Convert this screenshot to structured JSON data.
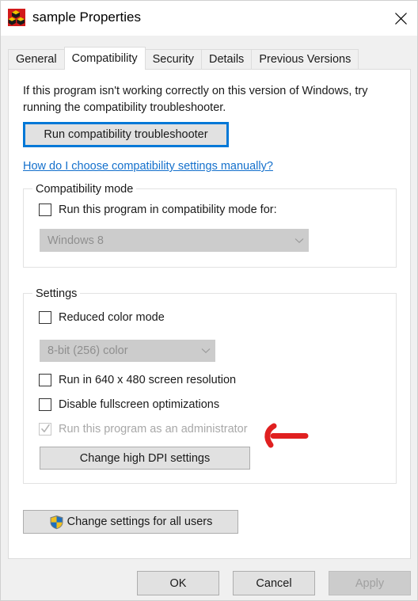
{
  "window": {
    "title": "sample Properties",
    "icon": "application-blocks-icon",
    "close_label": "✕"
  },
  "tabs": [
    {
      "label": "General",
      "active": false
    },
    {
      "label": "Compatibility",
      "active": true
    },
    {
      "label": "Security",
      "active": false
    },
    {
      "label": "Details",
      "active": false
    },
    {
      "label": "Previous Versions",
      "active": false
    }
  ],
  "compatibility_tab": {
    "description": "If this program isn't working correctly on this version of Windows, try running the compatibility troubleshooter.",
    "troubleshoot_button": "Run compatibility troubleshooter",
    "help_link": "How do I choose compatibility settings manually?",
    "compatibility_mode_group": {
      "title": "Compatibility mode",
      "checkbox_label": "Run this program in compatibility mode for:",
      "checkbox_checked": false,
      "os_dropdown_value": "Windows 8",
      "os_dropdown_disabled": true
    },
    "settings_group": {
      "title": "Settings",
      "reduced_color_label": "Reduced color mode",
      "reduced_color_checked": false,
      "color_depth_value": "8-bit (256) color",
      "color_depth_disabled": true,
      "low_resolution_label": "Run in 640 x 480 screen resolution",
      "low_resolution_checked": false,
      "disable_fullscreen_label": "Disable fullscreen optimizations",
      "disable_fullscreen_checked": false,
      "run_as_admin_label": "Run this program as an administrator",
      "run_as_admin_checked": true,
      "run_as_admin_disabled": true,
      "dpi_button": "Change high DPI settings"
    },
    "change_all_users_button": "Change settings for all users"
  },
  "footer": {
    "ok_label": "OK",
    "cancel_label": "Cancel",
    "apply_label": "Apply",
    "apply_disabled": true
  },
  "annotation": {
    "type": "red-arrow-pointing-left",
    "target": "run-as-administrator-checkbox",
    "color": "#e02020"
  },
  "colors": {
    "accent": "#0078d7",
    "link": "#1470cc",
    "panel_bg": "#ffffff",
    "dialog_bg": "#f0f0f0",
    "button_bg": "#e1e1e1",
    "disabled_text": "#a8a8a8",
    "annotation_red": "#e02020"
  }
}
